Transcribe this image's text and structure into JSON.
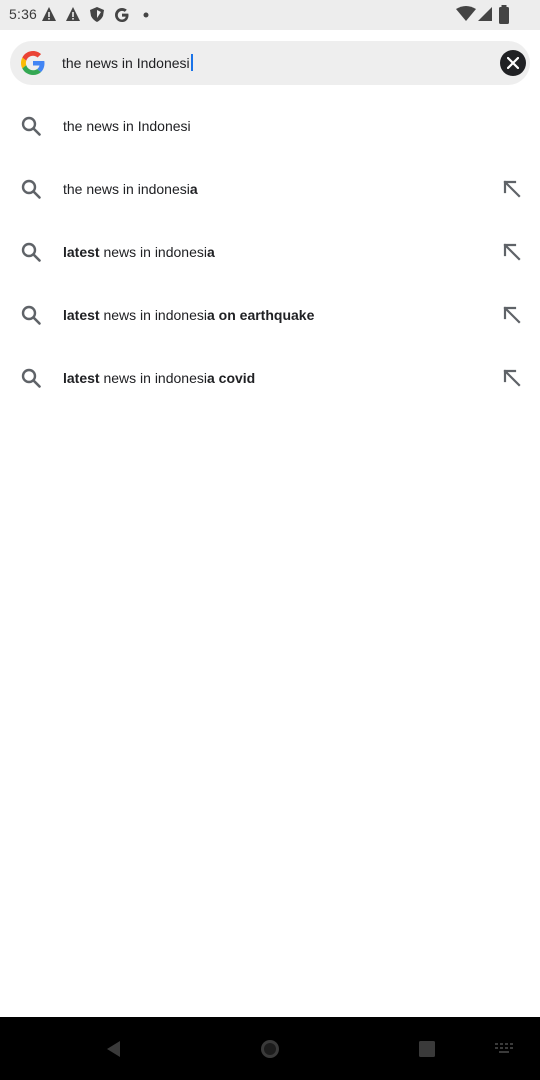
{
  "status_bar": {
    "time": "5:36",
    "icons": [
      "alert-icon",
      "alert-icon",
      "shield-icon",
      "google-icon",
      "dot-icon",
      "wifi-icon",
      "signal-icon",
      "battery-icon"
    ]
  },
  "search": {
    "query": "the news in Indonesi",
    "logo": "google-g-icon",
    "clear_icon": "close-icon"
  },
  "suggestions": [
    {
      "normal_prefix": "the news in Indonesi",
      "bold": "",
      "normal_suffix": "",
      "has_fill": false
    },
    {
      "normal_prefix": "the news in indonesi",
      "bold": "a",
      "normal_suffix": "",
      "has_fill": true
    },
    {
      "bold_prefix": "latest",
      "normal_prefix": " news in indonesi",
      "bold": "a",
      "normal_suffix": "",
      "has_fill": true
    },
    {
      "bold_prefix": "latest",
      "normal_prefix": " news in indonesi",
      "bold": "a on earthquake",
      "normal_suffix": "",
      "has_fill": true
    },
    {
      "bold_prefix": "latest",
      "normal_prefix": " news in indonesi",
      "bold": "a covid",
      "normal_suffix": "",
      "has_fill": true
    }
  ],
  "colors": {
    "status_bar_bg": "#ededed",
    "search_bg": "#eeeeee",
    "caret": "#1a73e8",
    "nav_bg": "#000000"
  }
}
